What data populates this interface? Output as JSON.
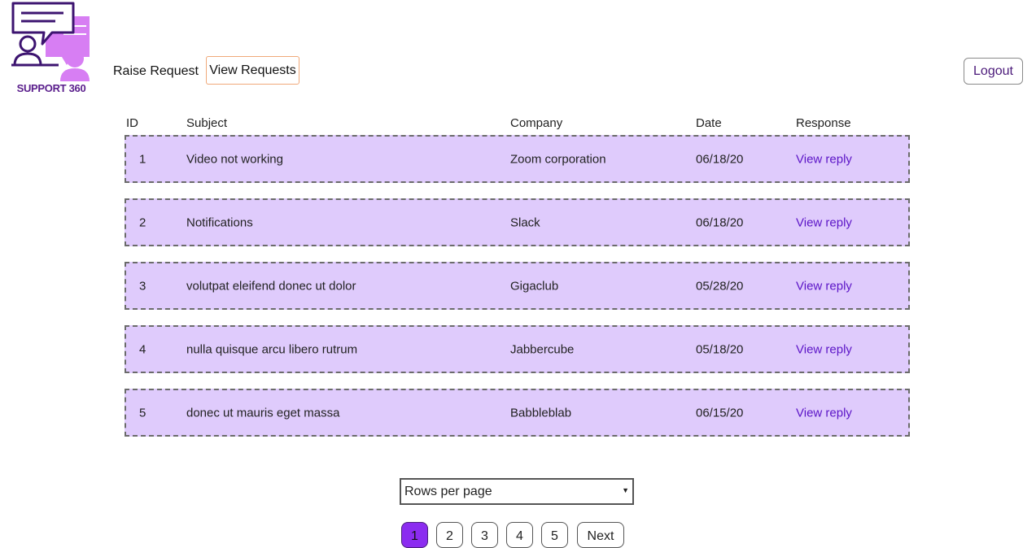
{
  "logo": {
    "text": "SUPPORT 360"
  },
  "nav": {
    "raise_request": "Raise Request",
    "view_requests": "View Requests",
    "logout": "Logout"
  },
  "table": {
    "headers": {
      "id": "ID",
      "subject": "Subject",
      "company": "Company",
      "date": "Date",
      "response": "Response"
    },
    "rows": [
      {
        "id": "1",
        "subject": "Video not working",
        "company": "Zoom corporation",
        "date": "06/18/20",
        "response": "View reply"
      },
      {
        "id": "2",
        "subject": "Notifications",
        "company": "Slack",
        "date": "06/18/20",
        "response": "View reply"
      },
      {
        "id": "3",
        "subject": "volutpat eleifend donec ut dolor",
        "company": "Gigaclub",
        "date": "05/28/20",
        "response": "View reply"
      },
      {
        "id": "4",
        "subject": "nulla quisque arcu libero rutrum",
        "company": "Jabbercube",
        "date": "05/18/20",
        "response": "View reply"
      },
      {
        "id": "5",
        "subject": "donec ut mauris eget massa",
        "company": "Babbleblab",
        "date": "06/15/20",
        "response": "View reply"
      }
    ]
  },
  "rows_per_page": {
    "label": "Rows per page"
  },
  "pagination": {
    "pages": [
      "1",
      "2",
      "3",
      "4",
      "5"
    ],
    "current": "1",
    "next": "Next"
  },
  "colors": {
    "row_bg": "#dfcbfc",
    "accent": "#8b2cf0",
    "link": "#5b14c7"
  }
}
